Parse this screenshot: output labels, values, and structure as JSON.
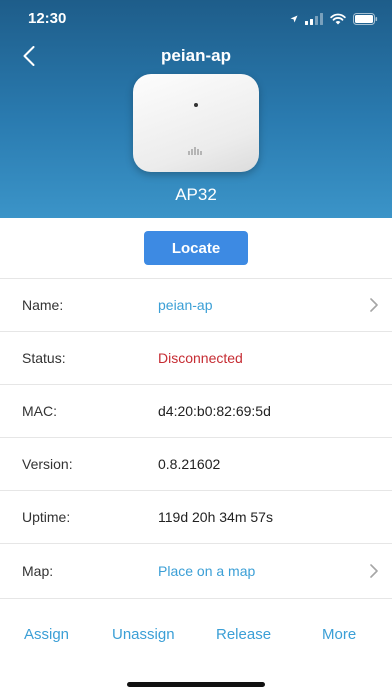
{
  "status_bar": {
    "time": "12:30"
  },
  "nav": {
    "title": "peian-ap",
    "back_icon": "chevron-left-icon"
  },
  "device": {
    "model": "AP32",
    "logo": "mist"
  },
  "locate_button": "Locate",
  "details": [
    {
      "label": "Name:",
      "value": "peian-ap",
      "style": "link",
      "chevron": true
    },
    {
      "label": "Status:",
      "value": "Disconnected",
      "style": "error",
      "chevron": false
    },
    {
      "label": "MAC:",
      "value": "d4:20:b0:82:69:5d",
      "style": "normal",
      "chevron": false
    },
    {
      "label": "Version:",
      "value": "0.8.21602",
      "style": "normal",
      "chevron": false
    },
    {
      "label": "Uptime:",
      "value": "119d 20h 34m 57s",
      "style": "normal",
      "chevron": false
    },
    {
      "label": "Map:",
      "value": "Place on a map",
      "style": "link",
      "chevron": true
    }
  ],
  "actions": {
    "assign": "Assign",
    "unassign": "Unassign",
    "release": "Release",
    "more": "More"
  },
  "colors": {
    "accent": "#3b9fd6",
    "button": "#3d8ae3",
    "error": "#c62c33",
    "hero": "#2a7bb0"
  }
}
